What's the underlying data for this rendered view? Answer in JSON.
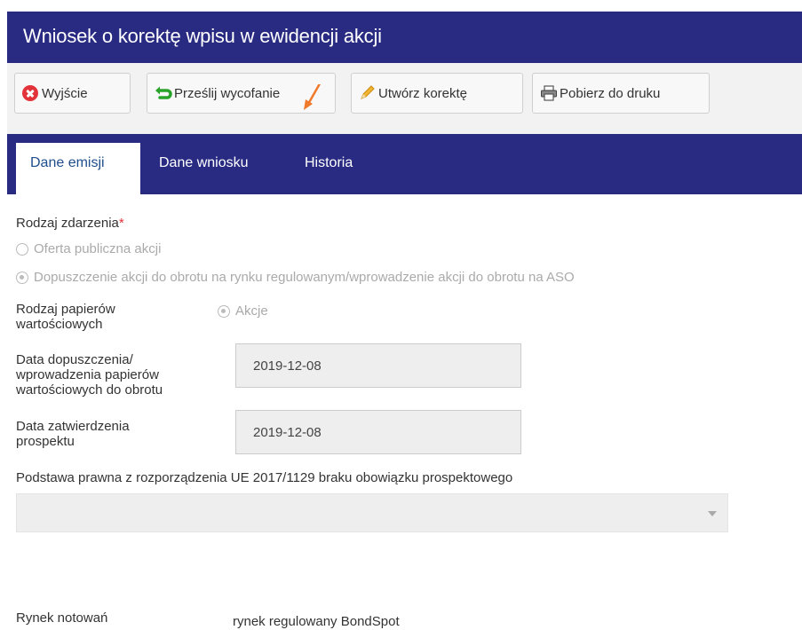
{
  "window": {
    "title": "Wniosek o korektę wpisu w ewidencji akcji"
  },
  "toolbar": {
    "exit_label": "Wyjście",
    "send_withdrawal_label": "Prześlij wycofanie",
    "create_correction_label": "Utwórz korektę",
    "download_print_label": "Pobierz do druku"
  },
  "tabs": [
    {
      "label": "Dane emisji",
      "active": true
    },
    {
      "label": "Dane wniosku",
      "active": false
    },
    {
      "label": "Historia",
      "active": false
    }
  ],
  "form": {
    "event_type": {
      "label": "Rodzaj zdarzenia",
      "required_mark": "*",
      "options": [
        {
          "label": "Oferta publiczna akcji",
          "selected": false
        },
        {
          "label": "Dopuszczenie akcji do obrotu na rynku regulowanym/wprowadzenie akcji do obrotu na ASO",
          "selected": true
        }
      ]
    },
    "securities_type": {
      "label_line1": "Rodzaj papierów",
      "label_line2": "wartościowych",
      "option": "Akcje"
    },
    "admission_date": {
      "label_line1": "Data dopuszczenia/",
      "label_line2": "wprowadzenia papierów",
      "label_line3": "wartościowych do obrotu",
      "value": "2019-12-08"
    },
    "prospectus_date": {
      "label_line1": "Data zatwierdzenia",
      "label_line2": "prospektu",
      "value": "2019-12-08"
    },
    "legal_basis": {
      "label": "Podstawa prawna z rozporządzenia UE 2017/1129 braku obowiązku prospektowego",
      "value": ""
    },
    "market": {
      "label": "Rynek notowań",
      "value": "rynek regulowany BondSpot"
    }
  },
  "colors": {
    "header_bg": "#292b82",
    "active_tab_text": "#1f4e8c",
    "required": "#e2333b",
    "annotation_arrow": "#f07a2a"
  }
}
